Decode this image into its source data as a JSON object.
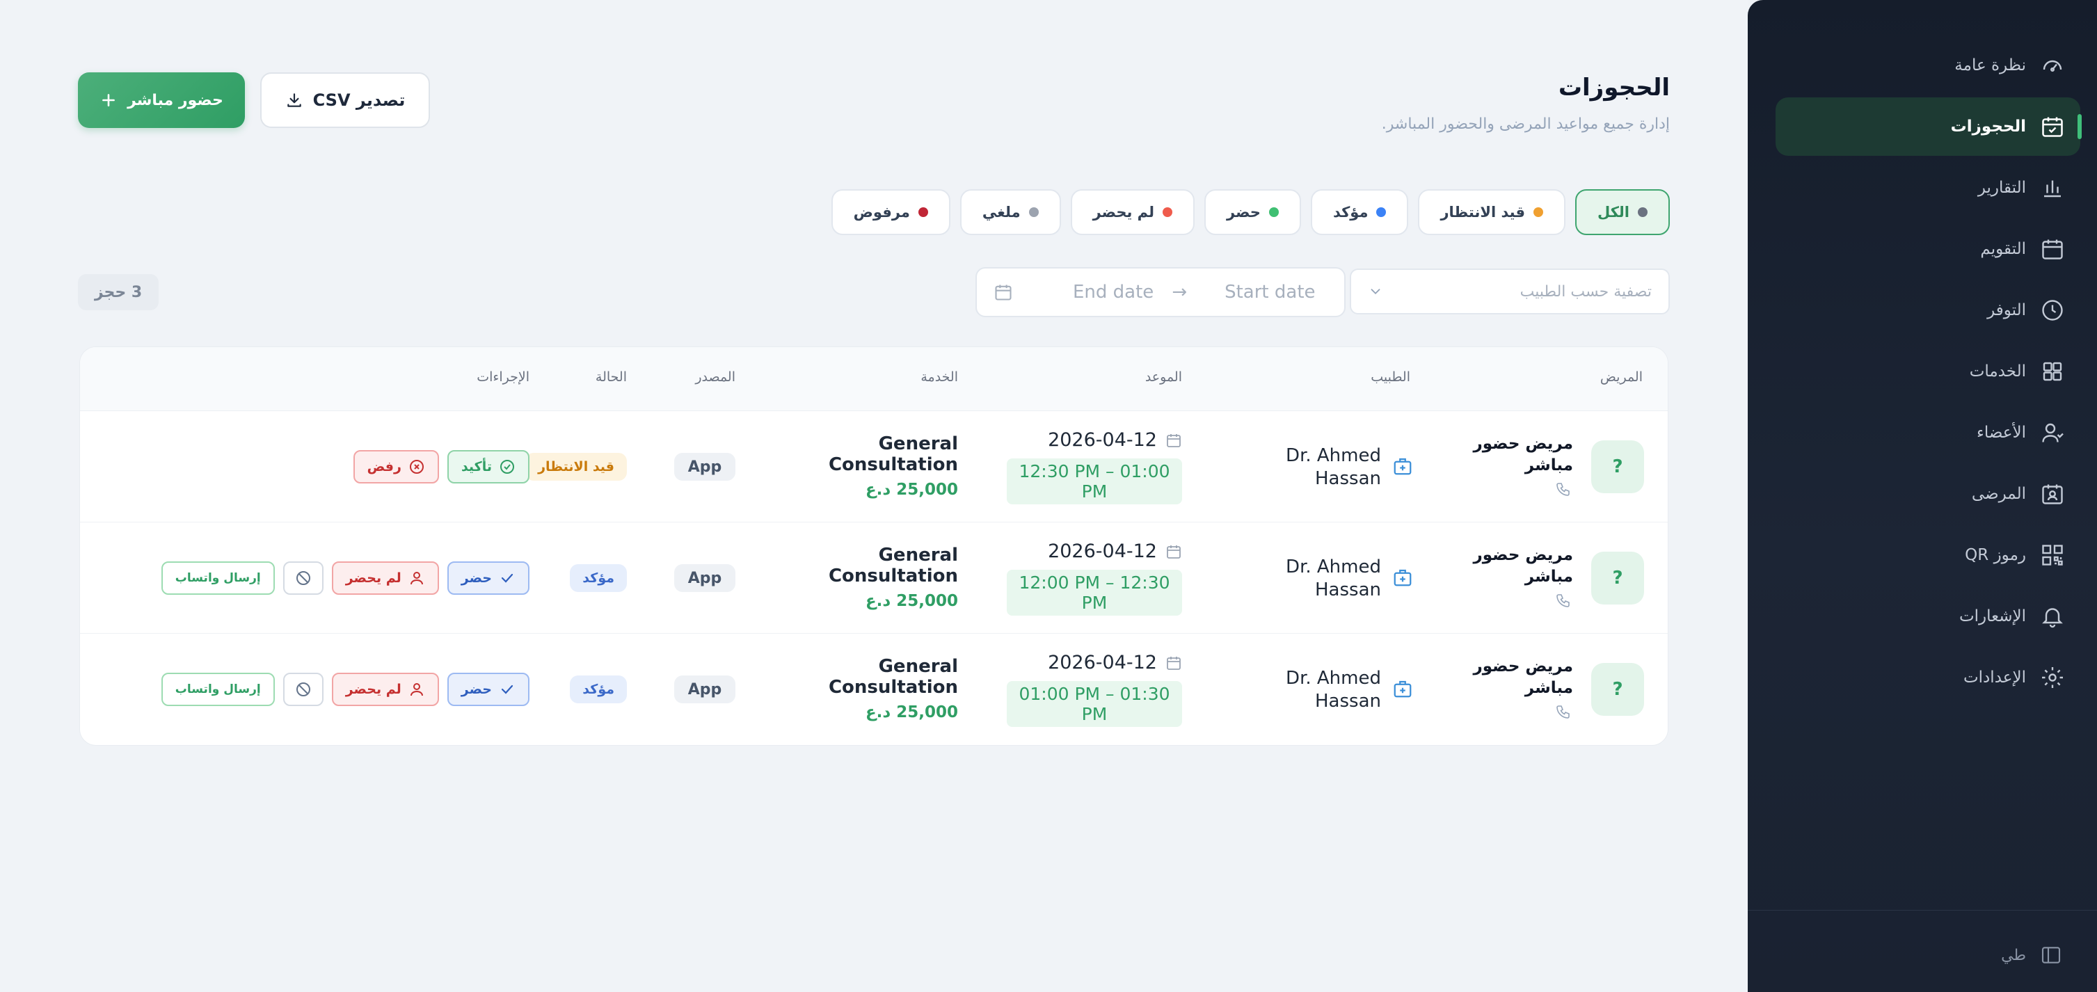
{
  "header": {
    "title": "الحجوزات",
    "subtitle": "إدارة جميع مواعيد المرضى والحضور المباشر.",
    "walkin_button": "حضور مباشر",
    "export_button": "تصدير CSV"
  },
  "status_filters": [
    {
      "label": "الكل",
      "color": "#6b7280",
      "active": true
    },
    {
      "label": "قيد الانتظار",
      "color": "#f0a030"
    },
    {
      "label": "مؤكد",
      "color": "#3b82f6"
    },
    {
      "label": "حضر",
      "color": "#3fbf72"
    },
    {
      "label": "لم يحضر",
      "color": "#ef5b4c"
    },
    {
      "label": "ملغي",
      "color": "#9ca3af"
    },
    {
      "label": "مرفوض",
      "color": "#c02636"
    }
  ],
  "filters": {
    "doctor_placeholder": "تصفية حسب الطبيب",
    "start_date_placeholder": "Start date",
    "end_date_placeholder": "End date",
    "arrow": "→"
  },
  "count_label": "3 حجز",
  "table": {
    "columns": {
      "patient": "المريض",
      "doctor": "الطبيب",
      "appointment": "الموعد",
      "service": "الخدمة",
      "source": "المصدر",
      "status": "الحالة",
      "actions": "الإجراءات"
    },
    "rows": [
      {
        "avatar": "?",
        "patient": "مريض حضور مباشر",
        "doctor": "Dr. Ahmed Hassan",
        "date": "2026-04-12",
        "time": "12:30 PM – 01:00 PM",
        "service": "General Consultation",
        "price": "25,000 د.ع",
        "source": "App",
        "status": "قيد الانتظار",
        "actions": {
          "confirm": "تأكيد",
          "reject": "رفض"
        }
      },
      {
        "avatar": "?",
        "patient": "مريض حضور مباشر",
        "doctor": "Dr. Ahmed Hassan",
        "date": "2026-04-12",
        "time": "12:00 PM – 12:30 PM",
        "service": "General Consultation",
        "price": "25,000 د.ع",
        "source": "App",
        "status": "مؤكد",
        "actions": {
          "attended": "حضر",
          "no_show": "لم يحضر",
          "whatsapp": "إرسال واتساب"
        }
      },
      {
        "avatar": "?",
        "patient": "مريض حضور مباشر",
        "doctor": "Dr. Ahmed Hassan",
        "date": "2026-04-12",
        "time": "01:00 PM – 01:30 PM",
        "service": "General Consultation",
        "price": "25,000 د.ع",
        "source": "App",
        "status": "مؤكد",
        "actions": {
          "attended": "حضر",
          "no_show": "لم يحضر",
          "whatsapp": "إرسال واتساب"
        }
      }
    ]
  },
  "sidebar": {
    "items": [
      {
        "label": "نظرة عامة",
        "icon": "gauge-icon"
      },
      {
        "label": "الحجوزات",
        "icon": "calendar-check-icon",
        "active": true
      },
      {
        "label": "التقارير",
        "icon": "bar-chart-icon"
      },
      {
        "label": "التقويم",
        "icon": "calendar-icon"
      },
      {
        "label": "التوفر",
        "icon": "clock-icon"
      },
      {
        "label": "الخدمات",
        "icon": "grid-icon"
      },
      {
        "label": "الأعضاء",
        "icon": "users-icon"
      },
      {
        "label": "المرضى",
        "icon": "patient-card-icon"
      },
      {
        "label": "رموز QR",
        "icon": "qr-code-icon"
      },
      {
        "label": "الإشعارات",
        "icon": "bell-icon"
      },
      {
        "label": "الإعدادات",
        "icon": "gear-icon"
      }
    ],
    "footer_user": "طي"
  }
}
